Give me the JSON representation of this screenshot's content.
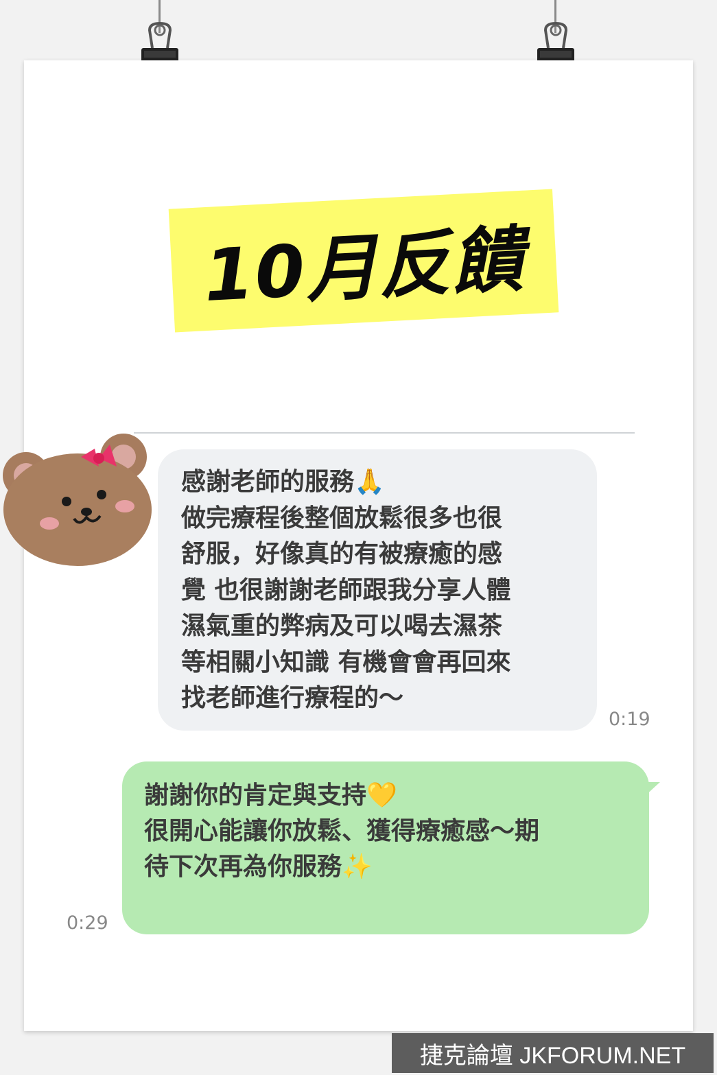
{
  "title": "10月反饋",
  "incoming_message": {
    "lines": [
      "感謝老師的服務🙏",
      "做完療程後整個放鬆很多也很",
      "舒服，好像真的有被療癒的感",
      "覺 也很謝謝老師跟我分享人體",
      "濕氣重的弊病及可以喝去濕茶",
      "等相關小知識 有機會會再回來",
      "找老師進行療程的～"
    ],
    "time": "0:19"
  },
  "outgoing_message": {
    "lines": [
      "謝謝你的肯定與支持💛",
      "很開心能讓你放鬆、獲得療癒感～期",
      "待下次再為你服務✨"
    ],
    "time": "0:29"
  },
  "watermark": "捷克論壇 JKFORUM.NET",
  "icons": {
    "binder_clip": "binder-clip-icon",
    "avatar": "bear-avatar-icon"
  },
  "colors": {
    "title_highlight": "#fdfc6e",
    "incoming_bubble": "#eff1f3",
    "outgoing_bubble": "#b6eab2"
  }
}
